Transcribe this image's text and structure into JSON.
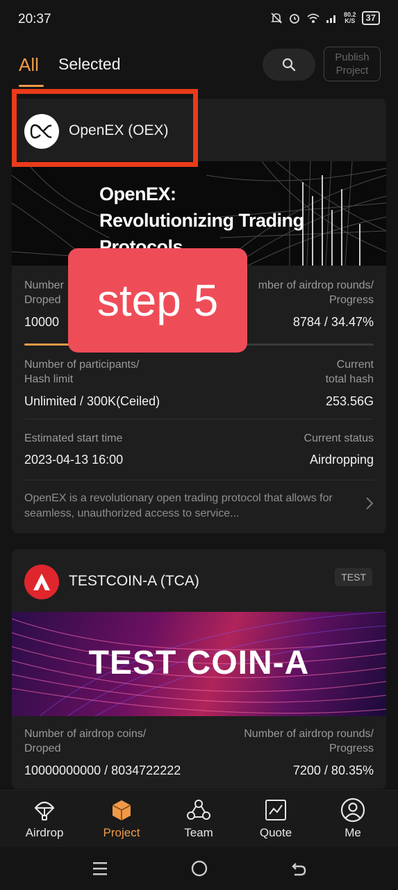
{
  "status_bar": {
    "time": "20:37",
    "net_speed": "80.2",
    "net_unit": "K/S",
    "battery": "37"
  },
  "tabs": {
    "all": "All",
    "selected": "Selected"
  },
  "publish": {
    "line1": "Publish",
    "line2": "Project"
  },
  "projects": [
    {
      "name": "OpenEX (OEX)",
      "banner": {
        "line1": "OpenEX:",
        "line2": "Revolutionizing Trading",
        "line3": "Protocols"
      },
      "stats": {
        "coins_label_l1": "Number",
        "coins_label_l2": "Droped",
        "rounds_label_l1": "mber of airdrop rounds/",
        "rounds_label_l2": "Progress",
        "coins_value": "10000",
        "rounds_value": "8784 / 34.47%",
        "progress": 0.3447,
        "participants_label_l1": "Number of participants/",
        "participants_label_l2": "Hash limit",
        "participants_value": "Unlimited / 300K(Ceiled)",
        "hash_label_l1": "Current",
        "hash_label_l2": "total hash",
        "hash_value": "253.56G",
        "start_label": "Estimated start time",
        "start_value": "2023-04-13 16:00",
        "status_label": "Current status",
        "status_value": "Airdropping"
      },
      "description": "OpenEX is a revolutionary open trading protocol that allows for seamless, unauthorized access to service..."
    },
    {
      "name": "TESTCOIN-A (TCA)",
      "badge": "TEST",
      "banner": {
        "text_a": "TEST ",
        "text_b": "COIN-A"
      },
      "stats": {
        "coins_label_l1": "Number of airdrop coins/",
        "coins_label_l2": "Droped",
        "rounds_label_l1": "Number of airdrop rounds/",
        "rounds_label_l2": "Progress",
        "coins_value": "10000000000 / 8034722222",
        "rounds_value": "7200 / 80.35%"
      }
    }
  ],
  "overlay": {
    "text": "step 5"
  },
  "nav": {
    "airdrop": "Airdrop",
    "project": "Project",
    "team": "Team",
    "quote": "Quote",
    "me": "Me"
  },
  "colors": {
    "accent": "#f09a47",
    "highlight_frame": "#ea3b1a",
    "overlay": "#ee4d58",
    "background": "#141414",
    "card": "#1e1e1e"
  }
}
